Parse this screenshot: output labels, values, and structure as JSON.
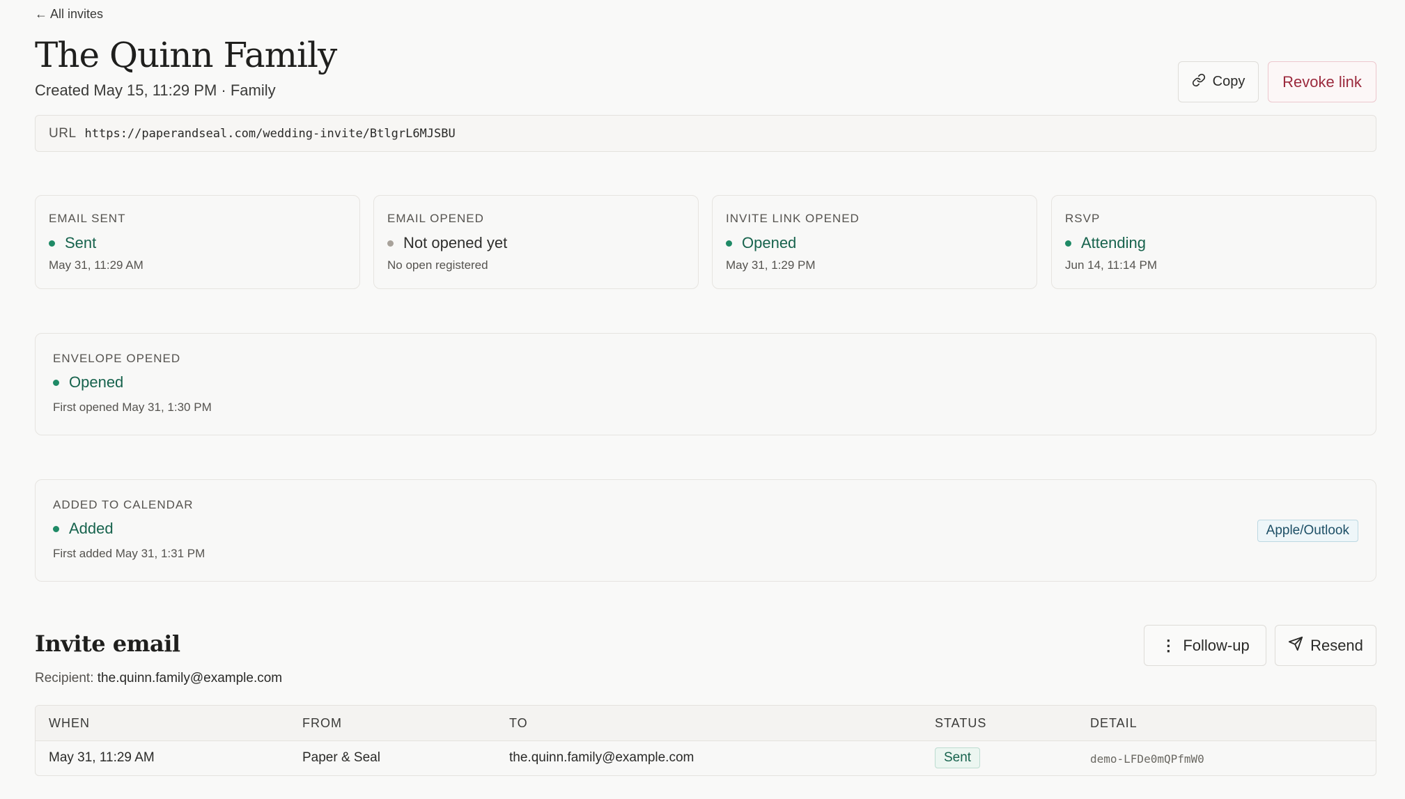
{
  "nav": {
    "back_label": "All invites"
  },
  "header": {
    "title": "The Quinn Family",
    "subtitle": "Created May 15, 11:29 PM · Family",
    "copy_label": "Copy",
    "revoke_label": "Revoke link"
  },
  "url": {
    "label": "URL",
    "value": "https://paperandseal.com/wedding-invite/BtlgrL6MJSBU"
  },
  "status_cards": [
    {
      "label": "EMAIL SENT",
      "status": "Sent",
      "detail": "May 31, 11:29 AM",
      "state": "done"
    },
    {
      "label": "EMAIL OPENED",
      "status": "Not opened yet",
      "detail": "No open registered",
      "state": "pending"
    },
    {
      "label": "INVITE LINK OPENED",
      "status": "Opened",
      "detail": "May 31, 1:29 PM",
      "state": "done"
    },
    {
      "label": "RSVP",
      "status": "Attending",
      "detail": "Jun 14, 11:14 PM",
      "state": "done"
    }
  ],
  "envelope": {
    "label": "ENVELOPE OPENED",
    "status": "Opened",
    "detail": "First opened May 31, 1:30 PM"
  },
  "calendar": {
    "label": "ADDED TO CALENDAR",
    "status": "Added",
    "detail": "First added May 31, 1:31 PM",
    "tag": "Apple/Outlook"
  },
  "invite_email": {
    "title": "Invite email",
    "recipient_label": "Recipient:",
    "recipient_value": "the.quinn.family@example.com",
    "followup_label": "Follow-up",
    "resend_label": "Resend",
    "columns": [
      "WHEN",
      "FROM",
      "TO",
      "STATUS",
      "DETAIL"
    ],
    "rows": [
      {
        "when": "May 31, 11:29 AM",
        "from": "Paper & Seal",
        "to": "the.quinn.family@example.com",
        "status": "Sent",
        "detail": "demo-LFDe0mQPfmW0"
      }
    ]
  },
  "colors": {
    "accent_green": "#17634d",
    "status_dot_green": "#1f8a66",
    "status_dot_gray": "#a8a29a",
    "revoke_red": "#9b2a3d",
    "tag_blue": "#1d4f66"
  },
  "icons": {
    "back": "arrow-left-icon",
    "copy": "link-icon",
    "followup": "kebab-icon",
    "resend": "send-icon"
  }
}
